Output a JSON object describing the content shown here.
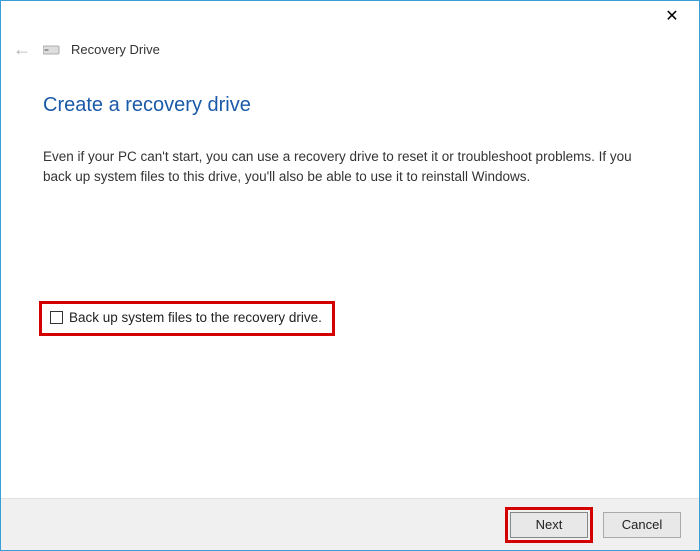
{
  "titlebar": {
    "close_icon": "✕"
  },
  "header": {
    "back_icon": "←",
    "title": "Recovery Drive"
  },
  "main": {
    "heading": "Create a recovery drive",
    "description": "Even if your PC can't start, you can use a recovery drive to reset it or troubleshoot problems. If you back up system files to this drive, you'll also be able to use it to reinstall Windows."
  },
  "checkbox": {
    "label": "Back up system files to the recovery drive.",
    "checked": false
  },
  "footer": {
    "next_label": "Next",
    "cancel_label": "Cancel"
  }
}
